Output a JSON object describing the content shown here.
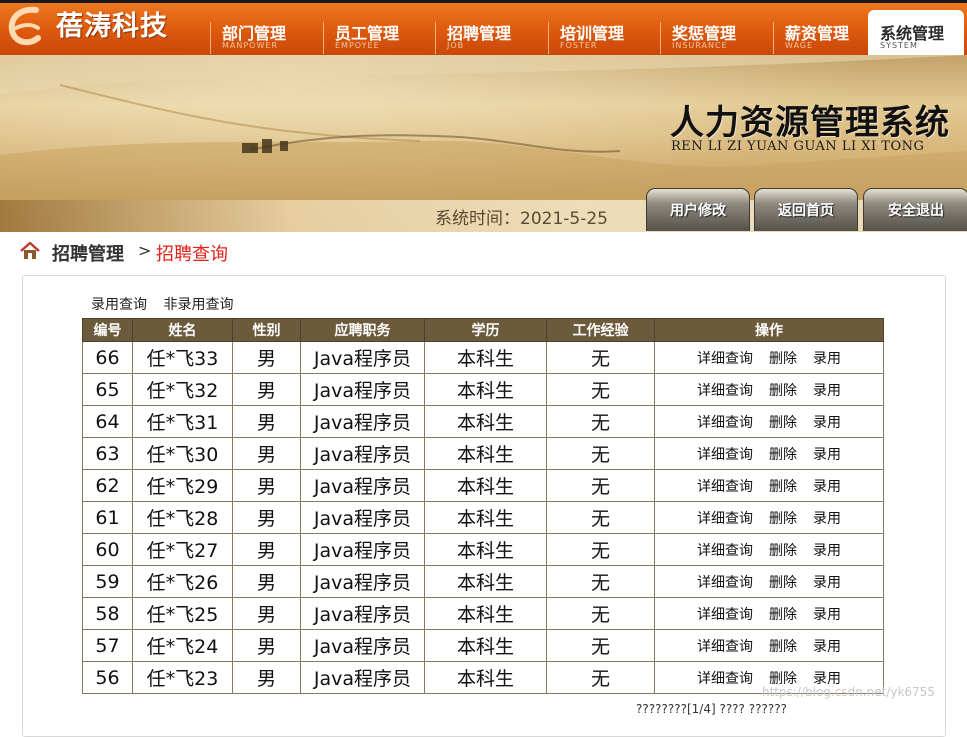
{
  "logo": {
    "text": "蓓涛科技"
  },
  "nav": [
    {
      "label": "部门管理",
      "sub": "MANPOWER"
    },
    {
      "label": "员工管理",
      "sub": "EMPOYEE"
    },
    {
      "label": "招聘管理",
      "sub": "JOB"
    },
    {
      "label": "培训管理",
      "sub": "FOSTER"
    },
    {
      "label": "奖惩管理",
      "sub": "INSURANCE"
    },
    {
      "label": "薪资管理",
      "sub": "WAGE"
    },
    {
      "label": "系统管理",
      "sub": "SYSTEM",
      "active": true
    }
  ],
  "banner": {
    "title_cn": "人力资源管理系统",
    "title_en": "REN LI ZI YUAN GUAN LI XI TONG",
    "system_time": "系统时间：2021-5-25",
    "buttons": {
      "user_edit": "用户修改",
      "home": "返回首页",
      "logout": "安全退出"
    }
  },
  "breadcrumb": {
    "section": "招聘管理",
    "separator": ">",
    "page": "招聘查询"
  },
  "filters": {
    "hired": "录用查询",
    "not_hired": "非录用查询"
  },
  "table": {
    "headers": [
      "编号",
      "姓名",
      "性别",
      "应聘职务",
      "学历",
      "工作经验",
      "操作"
    ],
    "actions": {
      "detail": "详细查询",
      "delete": "删除",
      "hire": "录用"
    },
    "rows": [
      {
        "id": "66",
        "name": "任*飞33",
        "gender": "男",
        "position": "Java程序员",
        "education": "本科生",
        "experience": "无"
      },
      {
        "id": "65",
        "name": "任*飞32",
        "gender": "男",
        "position": "Java程序员",
        "education": "本科生",
        "experience": "无"
      },
      {
        "id": "64",
        "name": "任*飞31",
        "gender": "男",
        "position": "Java程序员",
        "education": "本科生",
        "experience": "无"
      },
      {
        "id": "63",
        "name": "任*飞30",
        "gender": "男",
        "position": "Java程序员",
        "education": "本科生",
        "experience": "无"
      },
      {
        "id": "62",
        "name": "任*飞29",
        "gender": "男",
        "position": "Java程序员",
        "education": "本科生",
        "experience": "无"
      },
      {
        "id": "61",
        "name": "任*飞28",
        "gender": "男",
        "position": "Java程序员",
        "education": "本科生",
        "experience": "无"
      },
      {
        "id": "60",
        "name": "任*飞27",
        "gender": "男",
        "position": "Java程序员",
        "education": "本科生",
        "experience": "无"
      },
      {
        "id": "59",
        "name": "任*飞26",
        "gender": "男",
        "position": "Java程序员",
        "education": "本科生",
        "experience": "无"
      },
      {
        "id": "58",
        "name": "任*飞25",
        "gender": "男",
        "position": "Java程序员",
        "education": "本科生",
        "experience": "无"
      },
      {
        "id": "57",
        "name": "任*飞24",
        "gender": "男",
        "position": "Java程序员",
        "education": "本科生",
        "experience": "无"
      },
      {
        "id": "56",
        "name": "任*飞23",
        "gender": "男",
        "position": "Java程序员",
        "education": "本科生",
        "experience": "无"
      }
    ]
  },
  "pager": {
    "text": "????????[1/4]    ????  ??????"
  },
  "watermark": "https://blog.csdn.net/yk6755",
  "colors": {
    "topbar": "#de5a0e",
    "table_header": "#6b5a3c",
    "breadcrumb_current": "#e2231a"
  }
}
